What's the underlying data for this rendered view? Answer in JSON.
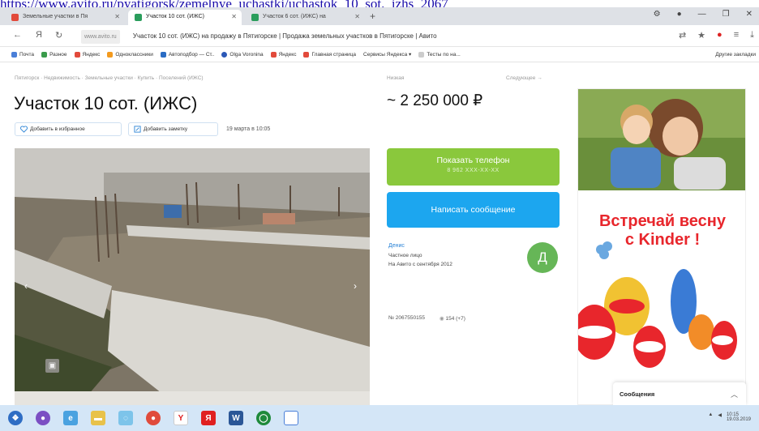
{
  "url_strip": "https://www.avito.ru/pyatigorsk/zemelnye_uchastki/uchastok_10_sot._izhs_2067",
  "browser": {
    "tabs": [
      {
        "label": "Земельные участки в Пя"
      },
      {
        "label": "Участок 10 сот. (ИЖС)"
      },
      {
        "label": "Участок 6 сот. (ИЖС) на"
      }
    ],
    "new_tab": "+",
    "omnibox_domain": "www.avito.ru",
    "page_title": "Участок 10 сот. (ИЖС) на продажу в Пятигорске | Продажа земельных участков в Пятигорске | Авито"
  },
  "bookmarks": {
    "items": [
      "Почта",
      "Разное",
      "Яндекс",
      "Одноклассники",
      "Автоподбор — Ст..",
      "Olga Voronina",
      "Яндекс",
      "Главная страница",
      "Сервисы Яндекса ▾",
      "Тесты по на..."
    ],
    "other": "Другие закладки"
  },
  "page": {
    "breadcrumbs": "Пятигорск · Недвижимость · Земельные участки · Купить · Поселений (ИЖС)",
    "title": "Участок 10 сот. (ИЖС)",
    "favorite_label": "Добавить в избранное",
    "note_label": "Добавить заметку",
    "date": "19 марта в 10:05",
    "price_label": "Низкая",
    "follow_label": "Следующее →",
    "price": "~ 2 250 000 ₽",
    "phone_button": "Показать телефон",
    "phone_masked": "8 962 XXX-XX-XX",
    "message_button": "Написать сообщение",
    "seller_name": "Денис",
    "seller_type": "Частное лицо",
    "seller_since": "На Авито с сентября 2012",
    "avatar_letter": "Д",
    "ad_number": "№ 2067550155",
    "views": "154 (+7)",
    "banner_slogan_line1": "Встречай весну",
    "banner_slogan_line2": "с Kinder !",
    "messages_label": "Сообщения"
  },
  "taskbar": {
    "clock_time": "10:15",
    "clock_date": "19.03.2019"
  },
  "colors": {
    "phone_green": "#8ac83c",
    "message_blue": "#1ca6ef",
    "avatar_green": "#66b657",
    "kinder_red": "#e8262c"
  }
}
